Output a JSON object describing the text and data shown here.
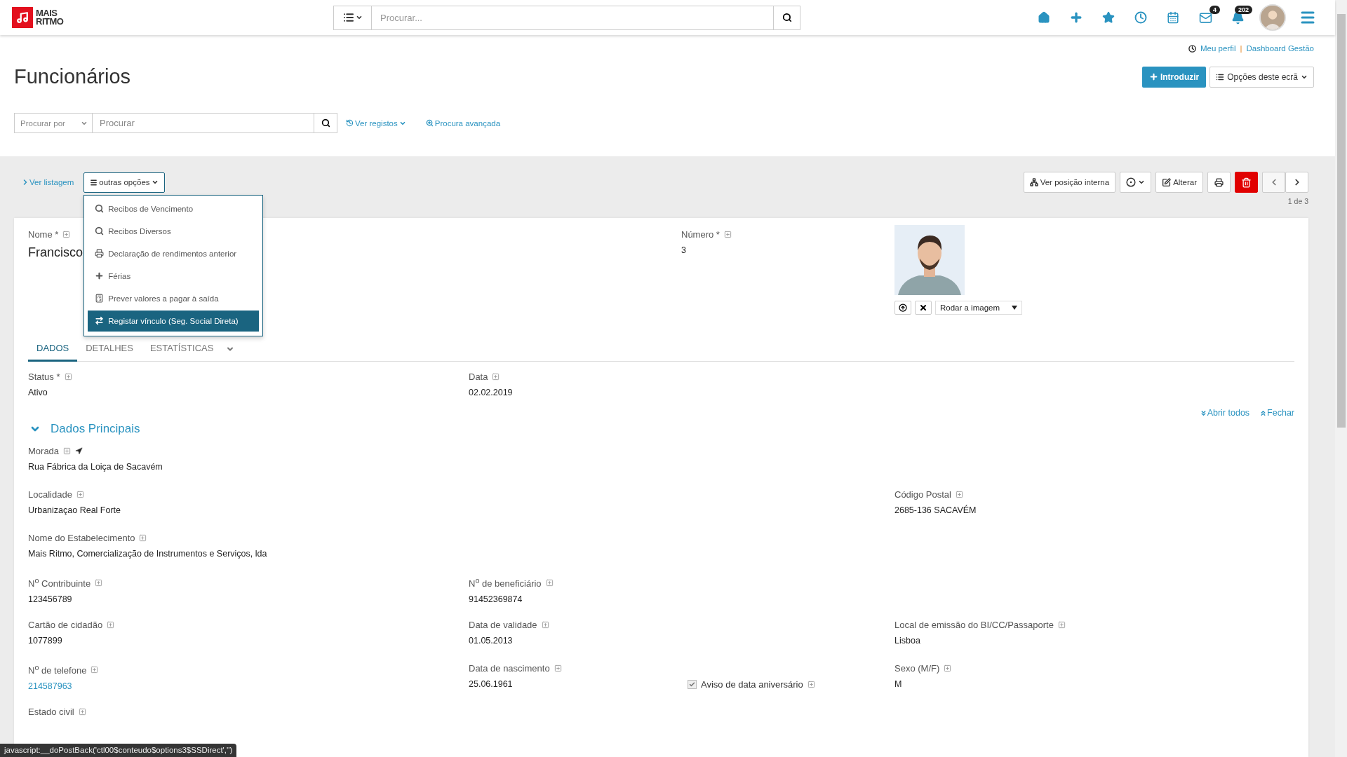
{
  "header": {
    "logo_lines": [
      "MAIS",
      "RITMO"
    ],
    "search_placeholder": "Procurar...",
    "nav": [
      {
        "kind": "home"
      },
      {
        "kind": "plus"
      },
      {
        "kind": "star"
      },
      {
        "kind": "clock"
      },
      {
        "kind": "calendar"
      },
      {
        "kind": "mail",
        "badge": "4"
      },
      {
        "kind": "bell",
        "badge": "202"
      },
      {
        "kind": "avatar"
      },
      {
        "kind": "menu"
      }
    ]
  },
  "user_links": {
    "profile": "Meu perfil",
    "separator": "|",
    "dashboard": "Dashboard Gestão"
  },
  "page_title": "Funcionários",
  "actions": {
    "primary": "Introduzir",
    "options": "Opções deste ecrã"
  },
  "filter": {
    "select_placeholder": "Procurar por",
    "search_placeholder": "Procurar",
    "links": [
      {
        "kind": "history",
        "label": "Ver registos",
        "dropdown": true
      },
      {
        "kind": "zoom",
        "label": "Procura avançada",
        "dropdown": false
      }
    ]
  },
  "toolbar": {
    "back": "Ver listagem",
    "more": "outras opções",
    "buttons": [
      {
        "kind": "org",
        "label": "Ver posição interna"
      },
      {
        "kind": "target"
      },
      {
        "kind": "edit",
        "label": "Alterar"
      },
      {
        "kind": "print"
      },
      {
        "kind": "delete"
      },
      {
        "kind": "prev"
      },
      {
        "kind": "next"
      }
    ],
    "pager": "1 de 3"
  },
  "menu": {
    "items": [
      {
        "kind": "search",
        "label": "Recibos de Vencimento",
        "selected": false
      },
      {
        "kind": "search",
        "label": "Recibos Diversos",
        "selected": false
      },
      {
        "kind": "print",
        "label": "Declaração de rendimentos anterior",
        "selected": false
      },
      {
        "kind": "plus",
        "label": "Férias",
        "selected": false
      },
      {
        "kind": "calculator",
        "label": "Prever valores a pagar à saída",
        "selected": false
      },
      {
        "kind": "exchange",
        "label": "Registar vínculo (Seg. Social Direta)",
        "selected": true
      }
    ]
  },
  "record": {
    "name_label": "Nome *",
    "name": "Francisco",
    "number_label": "Número *",
    "number": "3",
    "rotate": "Rodar a imagem"
  },
  "tabs": [
    {
      "label": "DADOS",
      "selected": true
    },
    {
      "label": "DETALHES",
      "selected": false
    },
    {
      "label": "ESTATÍSTICAS",
      "selected": false
    }
  ],
  "status_fields": [
    {
      "label": "Status *",
      "value": "Ativo"
    },
    {
      "label": "Data",
      "value": "02.02.2019"
    }
  ],
  "section": {
    "title": "Dados Principais",
    "expanded": true,
    "expand_all": "Abrir todos",
    "collapse": "Fechar"
  },
  "rows": [
    [
      {
        "kind": "text",
        "label": "Morada",
        "value": "Rua Fábrica da Loiça de Sacavém",
        "map_link": true
      },
      {
        "kind": "blank"
      },
      {
        "kind": "blank"
      },
      {
        "kind": "blank"
      }
    ],
    [
      {
        "kind": "text",
        "label": "Localidade",
        "value": "Urbanizaçao Real Forte"
      },
      {
        "kind": "blank"
      },
      {
        "kind": "blank"
      },
      {
        "kind": "text",
        "label": "Código Postal",
        "value": "2685-136 SACAVÉM"
      }
    ],
    [
      {
        "kind": "text",
        "label": "Nome do Estabelecimento",
        "value": "Mais Ritmo, Comercialização de Instrumentos e Serviços, lda"
      },
      {
        "kind": "blank"
      },
      {
        "kind": "blank"
      },
      {
        "kind": "blank"
      }
    ],
    [
      {
        "kind": "text",
        "label": "N$^{o}$ Contribuinte",
        "value": "123456789"
      },
      {
        "kind": "text",
        "label": "N$^{o}$ de beneficiário",
        "value": "91452369874"
      },
      {
        "kind": "blank"
      },
      {
        "kind": "blank"
      }
    ],
    [
      {
        "kind": "text",
        "label": "Cartão de cidadão",
        "value": "1077899"
      },
      {
        "kind": "text",
        "label": "Data de validade",
        "value": "01.05.2013"
      },
      {
        "kind": "blank"
      },
      {
        "kind": "text",
        "label": "Local de emissão do BI/CC/Passaporte",
        "value": "Lisboa"
      }
    ],
    [
      {
        "kind": "link",
        "label": "N$^{o}$ de telefone",
        "value": "214587963"
      },
      {
        "kind": "text",
        "label": "Data de nascimento",
        "value": "25.06.1961"
      },
      {
        "kind": "checkbox",
        "label": "Aviso de data aniversário",
        "checked": true
      },
      {
        "kind": "text",
        "label": "Sexo (M/F)",
        "value": "M"
      }
    ],
    [
      {
        "kind": "text",
        "label": "Estado civil"
      },
      {
        "kind": "blank"
      },
      {
        "kind": "blank"
      },
      {
        "kind": "blank"
      }
    ]
  ],
  "status_url": "javascript:__doPostBack('ctl00$conteudo$options3$SSDirect','')"
}
